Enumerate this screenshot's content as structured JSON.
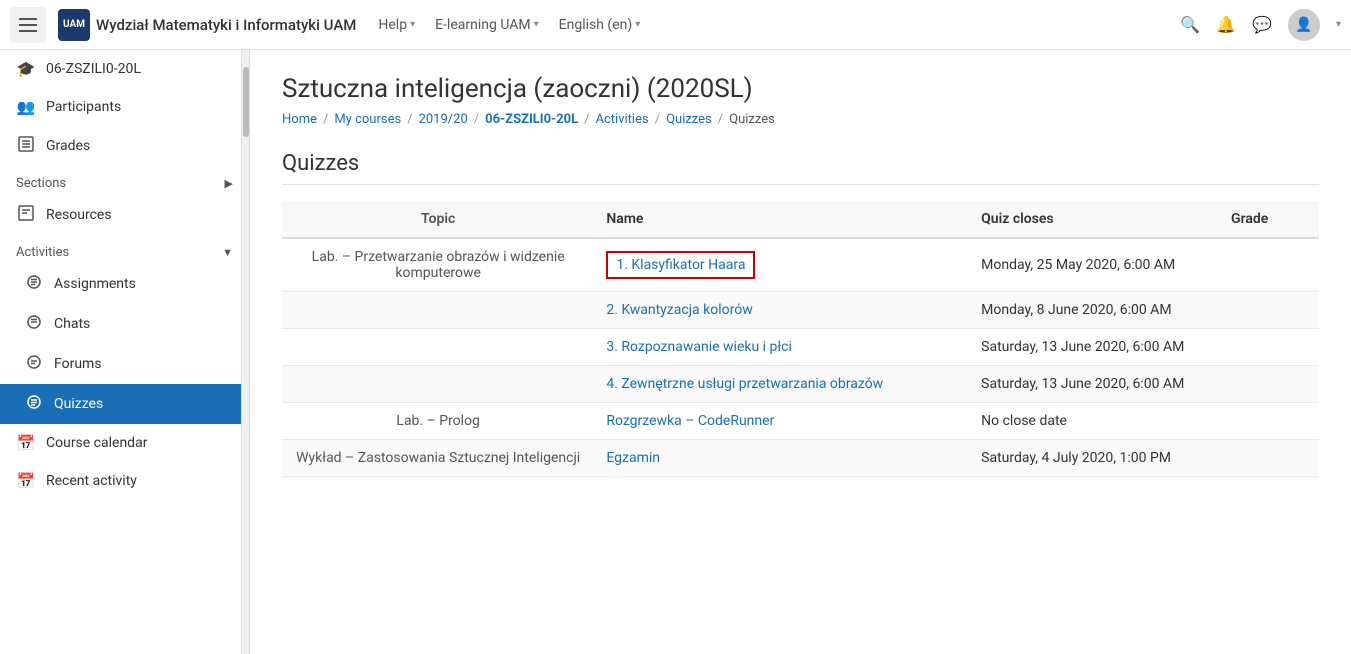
{
  "navbar": {
    "hamburger_label": "Menu",
    "logo_text": "UAM",
    "title": "Wydział Matematyki i Informatyki UAM",
    "nav_items": [
      {
        "label": "Help",
        "has_arrow": true
      },
      {
        "label": "E-learning UAM",
        "has_arrow": true
      },
      {
        "label": "English (en)",
        "has_arrow": true
      }
    ],
    "search_icon": "🔍",
    "bell_icon": "🔔",
    "chat_icon": "💬"
  },
  "sidebar": {
    "items": [
      {
        "id": "course",
        "label": "06-ZSZILI0-20L",
        "icon": "🎓",
        "active": false,
        "has_arrow": false
      },
      {
        "id": "participants",
        "label": "Participants",
        "icon": "👥",
        "active": false,
        "has_arrow": false
      },
      {
        "id": "grades",
        "label": "Grades",
        "icon": "⊞",
        "active": false,
        "has_arrow": false
      },
      {
        "id": "sections",
        "label": "Sections",
        "icon": "",
        "active": false,
        "has_arrow": true,
        "is_section": true
      },
      {
        "id": "resources",
        "label": "Resources",
        "icon": "▤",
        "active": false,
        "has_arrow": false
      },
      {
        "id": "activities",
        "label": "Activities",
        "icon": "",
        "active": false,
        "has_arrow": true,
        "is_section": true
      },
      {
        "id": "assignments",
        "label": "Assignments",
        "icon": "◈",
        "active": false,
        "has_arrow": false
      },
      {
        "id": "chats",
        "label": "Chats",
        "icon": "◈",
        "active": false,
        "has_arrow": false
      },
      {
        "id": "forums",
        "label": "Forums",
        "icon": "◈",
        "active": false,
        "has_arrow": false
      },
      {
        "id": "quizzes",
        "label": "Quizzes",
        "icon": "◈",
        "active": true,
        "has_arrow": false
      },
      {
        "id": "course-calendar",
        "label": "Course calendar",
        "icon": "📅",
        "active": false,
        "has_arrow": false
      },
      {
        "id": "recent-activity",
        "label": "Recent activity",
        "icon": "📅",
        "active": false,
        "has_arrow": false
      }
    ]
  },
  "page": {
    "title": "Sztuczna inteligencja (zaoczni) (2020SL)",
    "breadcrumb": [
      {
        "label": "Home",
        "link": true
      },
      {
        "label": "My courses",
        "link": true
      },
      {
        "label": "2019/20",
        "link": true
      },
      {
        "label": "06-ZSZILI0-20L",
        "link": true,
        "bold": true
      },
      {
        "label": "Activities",
        "link": true
      },
      {
        "label": "Quizzes",
        "link": true
      },
      {
        "label": "Quizzes",
        "link": false
      }
    ],
    "section_title": "Quizzes",
    "table": {
      "headers": [
        "Topic",
        "Name",
        "Quiz closes",
        "Grade"
      ],
      "rows": [
        {
          "topic": "Lab. – Przetwarzanie obrazów i widzenie komputerowe",
          "name": "1. Klasyfikator Haara",
          "name_link": true,
          "name_highlighted": true,
          "closes": "Monday, 25 May 2020, 6:00 AM",
          "grade": ""
        },
        {
          "topic": "",
          "name": "2. Kwantyzacja kolorów",
          "name_link": true,
          "name_highlighted": false,
          "closes": "Monday, 8 June 2020, 6:00 AM",
          "grade": ""
        },
        {
          "topic": "",
          "name": "3. Rozpoznawanie wieku i płci",
          "name_link": true,
          "name_highlighted": false,
          "closes": "Saturday, 13 June 2020, 6:00 AM",
          "grade": ""
        },
        {
          "topic": "",
          "name": "4. Zewnętrzne usługi przetwarzania obrazów",
          "name_link": true,
          "name_highlighted": false,
          "closes": "Saturday, 13 June 2020, 6:00 AM",
          "grade": ""
        },
        {
          "topic": "Lab. – Prolog",
          "name": "Rozgrzewka – CodeRunner",
          "name_link": true,
          "name_highlighted": false,
          "closes": "No close date",
          "grade": ""
        },
        {
          "topic": "Wykład – Zastosowania Sztucznej Inteligencji",
          "name": "Egzamin",
          "name_link": true,
          "name_highlighted": false,
          "closes": "Saturday, 4 July 2020, 1:00 PM",
          "grade": ""
        }
      ]
    }
  }
}
